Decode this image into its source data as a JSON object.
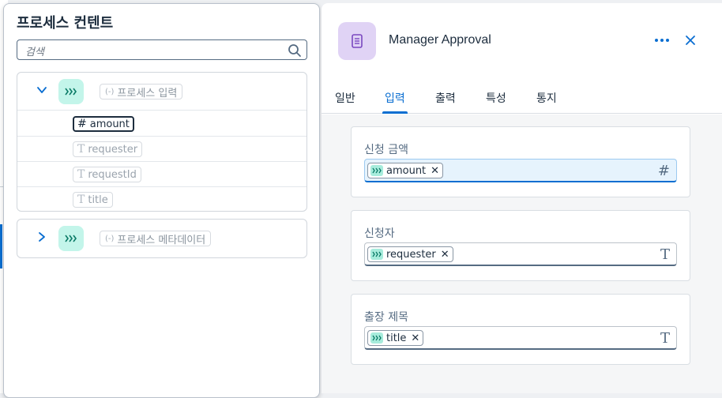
{
  "popover": {
    "title": "프로세스 컨텐트",
    "search_placeholder": "검색",
    "group1": {
      "label": "프로세스 입력",
      "tag": "(-)",
      "expanded": true,
      "items": [
        {
          "label": "amount",
          "type_glyph": "#",
          "active": true
        },
        {
          "label": "requester",
          "type_glyph": "T",
          "active": false
        },
        {
          "label": "requestId",
          "type_glyph": "T",
          "active": false
        },
        {
          "label": "title",
          "type_glyph": "T",
          "active": false
        }
      ]
    },
    "group2": {
      "label": "프로세스 메타데이터",
      "tag": "(-)",
      "expanded": false
    }
  },
  "panel": {
    "title": "Manager Approval",
    "tabs": [
      "일반",
      "입력",
      "출력",
      "특성",
      "통지"
    ],
    "selected_tab": "입력",
    "fields": [
      {
        "label": "신청 금액",
        "token": "amount",
        "type_glyph": "#",
        "focused": true
      },
      {
        "label": "신청자",
        "token": "requester",
        "type_glyph": "T",
        "focused": false
      },
      {
        "label": "출장 제목",
        "token": "title",
        "type_glyph": "T",
        "focused": false
      }
    ]
  },
  "colors": {
    "accent": "#0a6ed1",
    "node_icon_bg": "#c3f5ea",
    "header_icon_bg": "#e0d3f5",
    "focused_field_bg": "#e6f3fd"
  },
  "icons": {
    "search": "search-icon",
    "flow": "flow-arrows-icon",
    "header": "document-icon",
    "more": "more-icon",
    "close": "close-icon"
  }
}
